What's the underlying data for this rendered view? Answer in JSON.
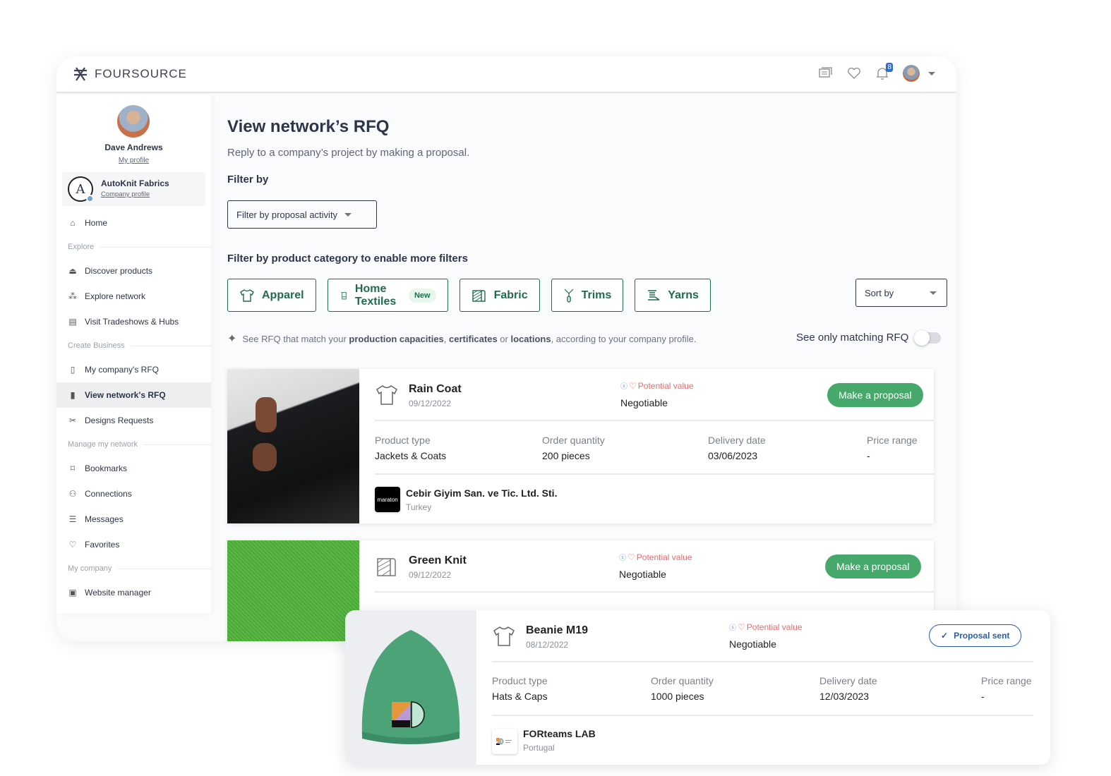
{
  "app": {
    "brand": "FOURSOURCE"
  },
  "topbar": {
    "notifications_count": "8",
    "icons": [
      "messages-icon",
      "heart-icon",
      "bell-icon",
      "avatar",
      "chevron-down-icon"
    ]
  },
  "sidebar": {
    "user_name": "Dave Andrews",
    "profile_link": "My profile",
    "company_name": "AutoKnit Fabrics",
    "company_link": "Company profile",
    "home": "Home",
    "sections": {
      "explore": "Explore",
      "create": "Create Business",
      "manage": "Manage my network",
      "company": "My company"
    },
    "items": {
      "discover": "Discover products",
      "network": "Explore network",
      "tradeshows": "Visit Tradeshows & Hubs",
      "my_rfq": "My company's RFQ",
      "view_rfq": "View network's RFQ",
      "designs": "Designs Requests",
      "bookmarks": "Bookmarks",
      "connections": "Connections",
      "messages": "Messages",
      "favorites": "Favorites",
      "website": "Website manager"
    }
  },
  "main": {
    "title": "View network’s RFQ",
    "subtitle": "Reply to a company’s project by making a proposal.",
    "filter_heading": "Filter by",
    "filter_dropdown": "Filter by proposal activity",
    "category_heading": "Filter by product category to enable more filters",
    "categories": [
      {
        "label": "Apparel"
      },
      {
        "label": "Home Textiles",
        "badge": "New"
      },
      {
        "label": "Fabric"
      },
      {
        "label": "Trims"
      },
      {
        "label": "Yarns"
      }
    ],
    "sort_label": "Sort by",
    "hint": {
      "pre": "See RFQ that match your ",
      "b1": "production capacities",
      "sep1": ", ",
      "b2": "certificates",
      "sep2": " or ",
      "b3": "locations",
      "post": ", according to your company profile."
    },
    "matching_toggle_label": "See only matching RFQ",
    "matching_toggle_on": false
  },
  "labels": {
    "potential_value": "Potential value",
    "product_type": "Product type",
    "order_quantity": "Order quantity",
    "delivery_date": "Delivery date",
    "price_range": "Price range",
    "make_proposal": "Make a proposal",
    "proposal_sent": "Proposal sent"
  },
  "rfqs": [
    {
      "title": "Rain Coat",
      "date": "09/12/2022",
      "value": "Negotiable",
      "product_type": "Jackets & Coats",
      "order_quantity": "200 pieces",
      "delivery_date": "03/06/2023",
      "price_range": "-",
      "company": "Cebir Giyim San. ve Tic. Ltd. Sti.",
      "country": "Turkey",
      "company_logo_text": "maraton",
      "status": "open"
    },
    {
      "title": "Green Knit",
      "date": "09/12/2022",
      "value": "Negotiable",
      "status": "open"
    },
    {
      "title": "Beanie M19",
      "date": "08/12/2022",
      "value": "Negotiable",
      "product_type": "Hats & Caps",
      "order_quantity": "1000 pieces",
      "delivery_date": "12/03/2023",
      "price_range": "-",
      "company": "FORteams LAB",
      "country": "Portugal",
      "status": "sent"
    }
  ],
  "colors": {
    "brand_green": "#1e6b4e",
    "action_green": "#46a96b",
    "sent_blue": "#2a5ab8",
    "potential_red": "#e86b6b"
  }
}
